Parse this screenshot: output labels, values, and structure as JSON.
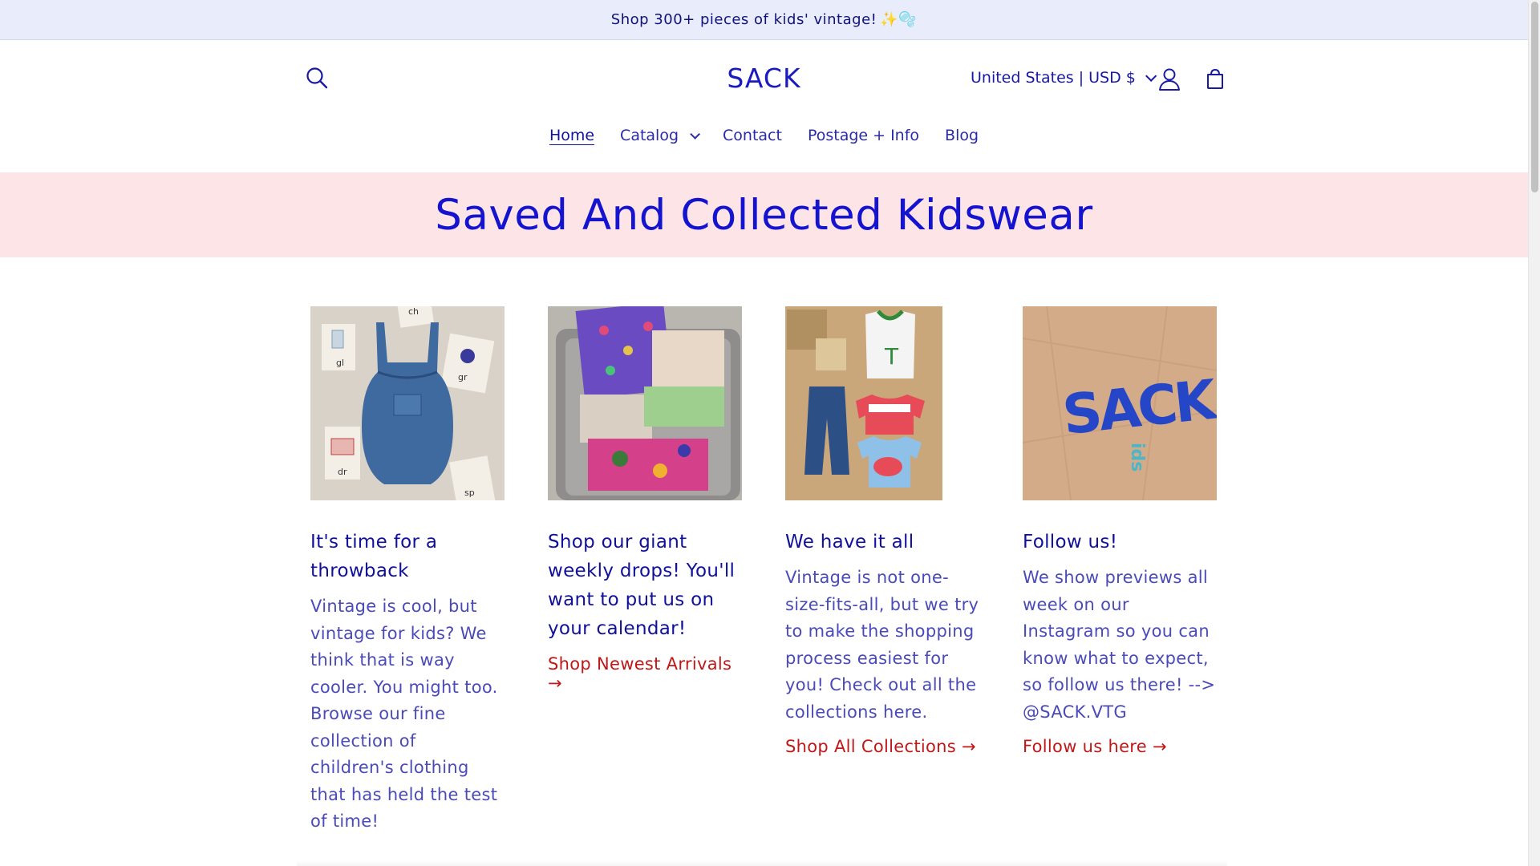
{
  "announcement": {
    "text": "Shop 300+ pieces of kids' vintage!",
    "emoji": "✨🫧"
  },
  "header": {
    "logo": "SACK",
    "currency": "United States | USD $",
    "icons": {
      "search": "search-icon",
      "account": "user-icon",
      "cart": "cart-icon"
    }
  },
  "nav": {
    "home": "Home",
    "catalog": "Catalog",
    "contact": "Contact",
    "postage": "Postage + Info",
    "blog": "Blog"
  },
  "hero": {
    "title": "Saved And Collected Kidswear"
  },
  "cards": [
    {
      "heading": "It's time for a throwback",
      "body": "Vintage is cool, but vintage for kids? We think that is way cooler. You might too. Browse our fine collection of children's clothing that has held the test of time!",
      "link": ""
    },
    {
      "heading": "Shop our giant weekly drops! You'll want to put us on your calendar!",
      "body": "",
      "link": "Shop Newest Arrivals →"
    },
    {
      "heading": "We have it all",
      "body": "Vintage is not one-size-fits-all, but we try to make the shopping process easiest for you! Check out all the collections here.",
      "link": "Shop All Collections →"
    },
    {
      "heading": "Follow us!",
      "body": "We show previews all week on our Instagram so you can know what to expect, so follow us there! --> @SACK.VTG",
      "link": "Follow us here →"
    }
  ],
  "card_images": {
    "card1_flashcards": [
      "ch",
      "gl",
      "gr",
      "dr",
      "sp"
    ],
    "card4_logo": {
      "main": "SACK",
      "sub": "ids"
    }
  },
  "colors": {
    "announcement_bg": "#e8ecfb",
    "hero_bg": "#fde4e6",
    "brand_blue": "#1414d0",
    "link_red": "#c01818"
  }
}
